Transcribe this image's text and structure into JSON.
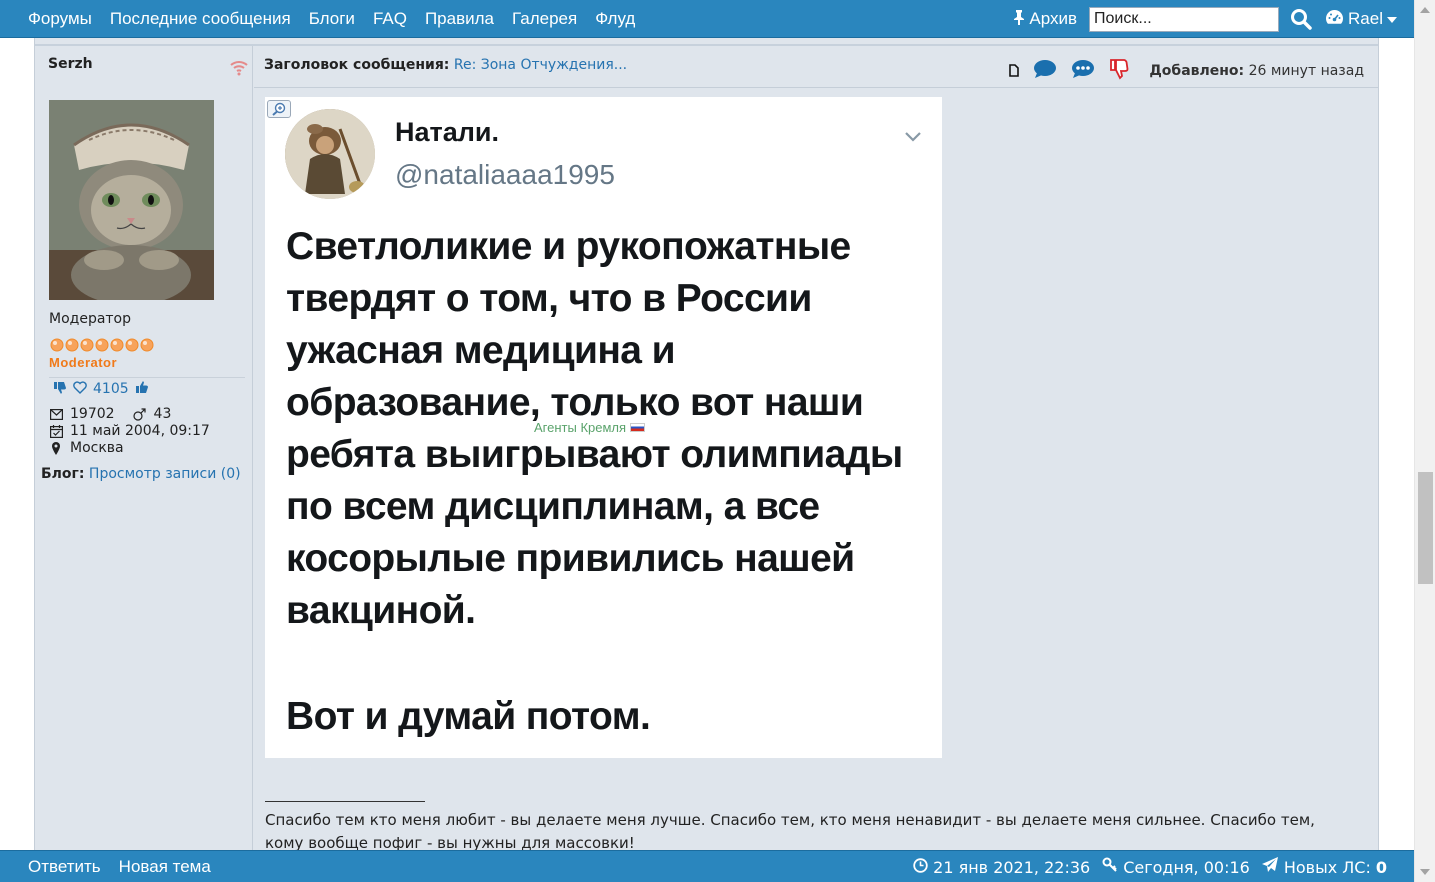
{
  "nav": {
    "links": [
      "Форумы",
      "Последние сообщения",
      "Блоги",
      "FAQ",
      "Правила",
      "Галерея",
      "Флуд"
    ],
    "archive_label": "Архив",
    "search_placeholder": "Поиск...",
    "user_label": "Rael"
  },
  "post": {
    "author": {
      "username": "Serzh",
      "title": "Модератор",
      "rank_label": "Moderator",
      "reputation": "4105",
      "posts": "19702",
      "age": "43",
      "joined": "11 май 2004, 09:17",
      "location": "Москва",
      "blog_label": "Блог:",
      "blog_link": "Просмотр записи (0)"
    },
    "subject_label": "Заголовок сообщения:",
    "subject": "Re: Зона Отчуждения...",
    "added_label": "Добавлено:",
    "added_time": "26 минут назад",
    "image": {
      "tweet_name": "Натали.",
      "tweet_handle": "@nataliaaaa1995",
      "tweet_lines": [
        "Светлоликие и рукопожатные",
        "твердят о том, что в России",
        "ужасная медицина и",
        "образование, только вот наши",
        "ребята выигрывают олимпиады",
        "по всем дисциплинам, а все",
        "косорылые привились нашей",
        "вакциной."
      ],
      "tweet_last_line": "Вот и думай потом.",
      "watermark": "Агенты Кремля"
    },
    "signature_line1": "Спасибо тем кто меня любит - вы делаете меня лучше. Спасибо тем, кто меня ненавидит - вы делаете меня сильнее. Спасибо тем,",
    "signature_line2": "кому вообще пофиг - вы нужны для массовки!"
  },
  "footer": {
    "reply_label": "Ответить",
    "new_topic_label": "Новая тема",
    "last_visit": "21 янв 2021, 22:36",
    "today": "Сегодня, 00:16",
    "new_pm_label": "Новых ЛС:",
    "new_pm_count": "0"
  },
  "colors": {
    "bar": "#2a86be",
    "post_bg": "#dfe5ec",
    "link": "#2673b0",
    "rank": "#f07a1a",
    "dislike": "#d9262c"
  }
}
